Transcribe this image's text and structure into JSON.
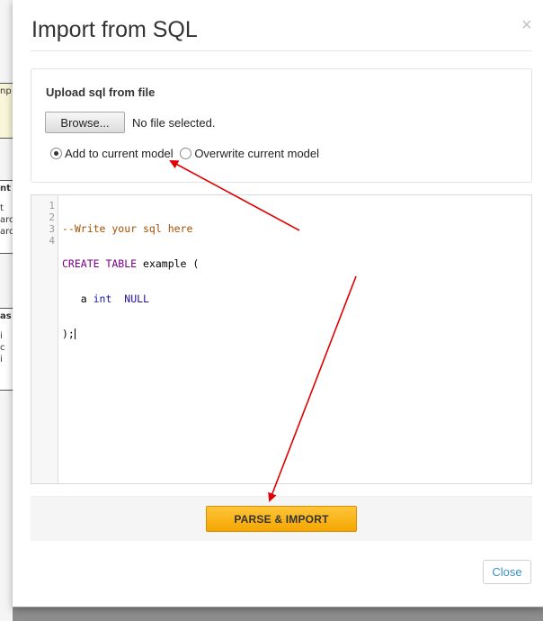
{
  "background": {
    "fragments": [
      "np",
      "nt",
      "t",
      "arc",
      "arc",
      "as",
      "i",
      "c",
      "i"
    ]
  },
  "dialog": {
    "title": "Import from SQL",
    "close_icon": "×"
  },
  "upload": {
    "label": "Upload sql from file",
    "browse_label": "Browse...",
    "file_status": "No file selected.",
    "options": [
      {
        "label": "Add to current model",
        "selected": true
      },
      {
        "label": "Overwrite current model",
        "selected": false
      }
    ]
  },
  "editor": {
    "line_numbers": [
      "1",
      "2",
      "3",
      "4"
    ],
    "lines": {
      "l1_comment": "--Write your sql here",
      "l2_kw": "CREATE TABLE",
      "l2_rest": " example (",
      "l3_indent": "   a ",
      "l3_type": "int",
      "l3_gap": "  ",
      "l3_null": "NULL",
      "l4": ");"
    }
  },
  "actions": {
    "parse_label": "PARSE & IMPORT",
    "close_label": "Close"
  },
  "colors": {
    "annotation_arrow": "#e00000",
    "primary_button": "#f4a600",
    "link": "#3a8fc7"
  }
}
